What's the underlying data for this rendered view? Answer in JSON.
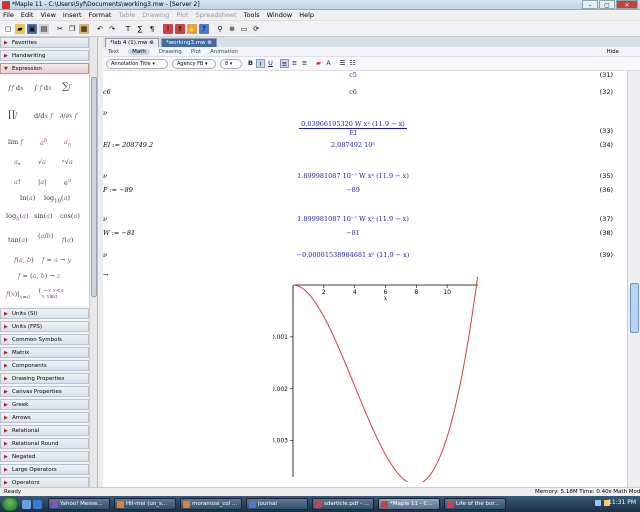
{
  "window": {
    "title": "*Maple 11 - C:\\Users\\Syf\\Documents\\working3.mw - [Server 2]"
  },
  "menu": [
    {
      "label": "File",
      "enabled": true
    },
    {
      "label": "Edit",
      "enabled": true
    },
    {
      "label": "View",
      "enabled": true
    },
    {
      "label": "Insert",
      "enabled": true
    },
    {
      "label": "Format",
      "enabled": true
    },
    {
      "label": "Table",
      "enabled": false
    },
    {
      "label": "Drawing",
      "enabled": false
    },
    {
      "label": "Plot",
      "enabled": false
    },
    {
      "label": "Spreadsheet",
      "enabled": false
    },
    {
      "label": "Tools",
      "enabled": true
    },
    {
      "label": "Window",
      "enabled": true
    },
    {
      "label": "Help",
      "enabled": true
    }
  ],
  "toolbar": {
    "buttons": [
      {
        "name": "new-icon",
        "glyph": "▢",
        "color": "#ffffff"
      },
      {
        "name": "open-icon",
        "glyph": "▰",
        "color": "#e8c45a"
      },
      {
        "name": "save-icon",
        "glyph": "▣",
        "color": "#4a6fb5"
      },
      {
        "name": "print-icon",
        "glyph": "▤",
        "color": "#d0d0d0"
      },
      {
        "name": "cut-icon",
        "glyph": "✂",
        "color": "#eeeeee"
      },
      {
        "name": "copy-icon",
        "glyph": "❐",
        "color": "#eeeeee"
      },
      {
        "name": "paste-icon",
        "glyph": "▦",
        "color": "#d9b16a"
      },
      {
        "name": "undo-icon",
        "glyph": "↶",
        "color": "#eeeeee"
      },
      {
        "name": "redo-icon",
        "glyph": "↷",
        "color": "#eeeeee"
      },
      {
        "name": "text-icon",
        "glyph": "T",
        "color": "#eeeeee"
      },
      {
        "name": "math-icon",
        "glyph": "∑",
        "color": "#eeeeee"
      },
      {
        "name": "insert-paragraph-icon",
        "glyph": "¶",
        "color": "#eeeeee"
      },
      {
        "name": "execute-icon",
        "glyph": "!",
        "color": "#d24040"
      },
      {
        "name": "execute-all-icon",
        "glyph": "‼",
        "color": "#d24040"
      },
      {
        "name": "stop-icon",
        "glyph": "✋",
        "color": "#e0a050"
      },
      {
        "name": "help-icon",
        "glyph": "?",
        "color": "#4a7ad0"
      },
      {
        "name": "magnifier-icon",
        "glyph": "⚲",
        "color": "#eeeeee"
      },
      {
        "name": "zoom-icon",
        "glyph": "⊕",
        "color": "#eeeeee"
      },
      {
        "name": "window-icon",
        "glyph": "▭",
        "color": "#eeeeee"
      },
      {
        "name": "restart-icon",
        "glyph": "⟳",
        "color": "#eeeeee"
      }
    ]
  },
  "tabs": [
    {
      "label": "*lab 4 (1).mw"
    },
    {
      "label": "*working3.mw",
      "active": true
    }
  ],
  "context_tabs": [
    "Text",
    "Math",
    "Drawing",
    "Plot",
    "Animation"
  ],
  "context_active": "Math",
  "hide_label": "Hide",
  "format": {
    "style": "Annotation Title",
    "font": "Agency FB",
    "size": "8"
  },
  "palettes": {
    "top": [
      "Favorites",
      "Handwriting"
    ],
    "open": "Expression",
    "bottom": [
      "Units (SI)",
      "Units (FPS)",
      "Common Symbols",
      "Matrix",
      "Components",
      "Drawing Properties",
      "Canvas Properties",
      "Greek",
      "Arrows",
      "Relational",
      "Relational Round",
      "Negated",
      "Large Operators",
      "Operators"
    ]
  },
  "doc": [
    {
      "lhs": "",
      "result": "c5",
      "eq": "(31)"
    },
    {
      "lhs": "c6",
      "result": "c6",
      "eq": "(32)"
    },
    {
      "lhs": "ν",
      "result": "",
      "eq": ""
    },
    {
      "lhs": "",
      "frac": {
        "num": "0.03966195320 W x² (11.9 − x)",
        "den": "EI"
      },
      "eq": "(33)"
    },
    {
      "lhs": "EI := 208749.2",
      "result": "2.087492 10⁵",
      "eq": "(34)"
    },
    {
      "lhs": "ν",
      "result": "1.899981087 10⁻⁷ W x² (11.9 − x)",
      "eq": "(35)"
    },
    {
      "lhs": "P := −89",
      "result": "−89",
      "eq": "(36)"
    },
    {
      "lhs": "ν",
      "result": "1.899981087 10⁻⁷ W x² (11.9 − x)",
      "eq": "(37)"
    },
    {
      "lhs": "W := −81",
      "result": "−81",
      "eq": "(38)"
    },
    {
      "lhs": "ν",
      "result": "−0.00001538984681 x² (11.9 − x)",
      "eq": "(39)"
    },
    {
      "lhs": "→",
      "result": "",
      "eq": ""
    }
  ],
  "chart_data": {
    "type": "line",
    "title": "",
    "xlabel": "x",
    "ylabel": "",
    "xlim": [
      0,
      12
    ],
    "ylim": [
      -0.0037,
      0
    ],
    "xticks": [
      "2",
      "4",
      "6",
      "8",
      "10"
    ],
    "yticks": [
      "-0.001",
      "-0.002",
      "-0.003"
    ],
    "formula": "-0.00001538984681 x^2 (11.9 - x)",
    "color": "#d04040",
    "x": [
      0,
      1,
      2,
      3,
      4,
      5,
      6,
      7,
      7.93,
      9,
      10,
      11,
      12
    ],
    "y": [
      0,
      -0.000168,
      -0.000609,
      -0.001223,
      -0.001908,
      -0.00256,
      -0.003073,
      -0.003344,
      -0.00337,
      -0.003101,
      -0.002386,
      -0.001167,
      0.000222
    ]
  },
  "status": {
    "left": "Ready",
    "right": "Memory: 5.18M   Time: 0.40s   Math Mode"
  },
  "taskbar": [
    {
      "label": "Yahoo! Messe...",
      "color": "#8a4fbf"
    },
    {
      "label": "Hil-mei (un_s...",
      "color": "#e08030"
    },
    {
      "label": "moramosi_col ...",
      "color": "#e08030"
    },
    {
      "label": "journal",
      "color": "#4a7ad0"
    },
    {
      "label": "sdarticle.pdf - ...",
      "color": "#d04040"
    },
    {
      "label": "*Maple 11 - C...",
      "color": "#d04040",
      "active": true
    },
    {
      "label": "Life of the bor...",
      "color": "#d04040"
    }
  ],
  "clock": "11:31 PM"
}
